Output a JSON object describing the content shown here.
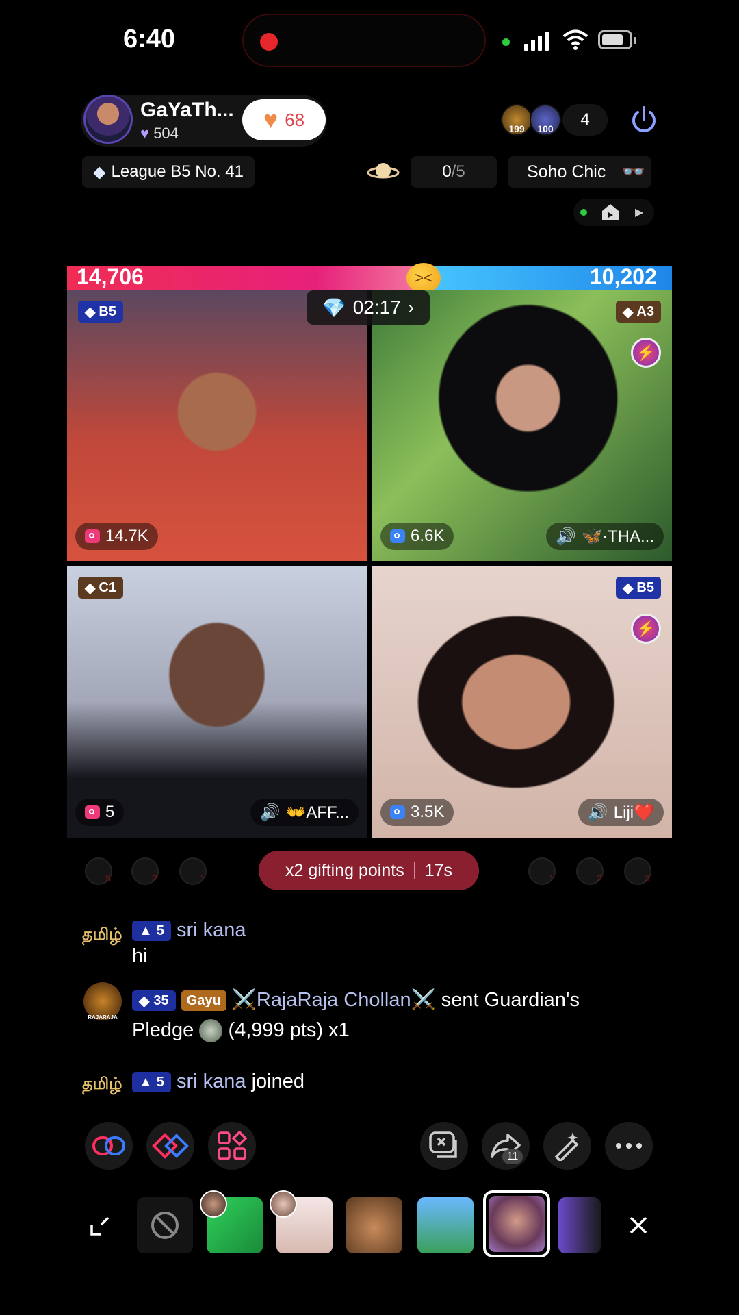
{
  "status_bar": {
    "time": "6:40"
  },
  "host": {
    "name": "GaYaTh...",
    "followers": "504",
    "likes": "68"
  },
  "viewers": {
    "count": "4",
    "avatar1_label": "199",
    "avatar2_label": "100"
  },
  "league": {
    "label": "League B5 No. 41"
  },
  "progress": {
    "current": "0",
    "total": "/5"
  },
  "room_tag": {
    "label": "Soho Chic"
  },
  "battle": {
    "score_left": "14,706",
    "score_right": "10,202",
    "timer": "02:17"
  },
  "tiles": [
    {
      "badge": "B5",
      "stat": "14.7K",
      "name": ""
    },
    {
      "badge": "A3",
      "stat": "6.6K",
      "name": "🦋·THA..."
    },
    {
      "badge": "C1",
      "stat": "5",
      "name": "👐AFF..."
    },
    {
      "badge": "B5",
      "stat": "3.5K",
      "name": "Liji❤️"
    }
  ],
  "gifting": {
    "label": "x2 gifting points",
    "countdown": "17s"
  },
  "ghost_left": [
    "5",
    "2",
    "1"
  ],
  "ghost_right": [
    "1",
    "2",
    "3"
  ],
  "chat": [
    {
      "avatar_text": "தமிழ்",
      "level": "5",
      "user": "sri kana",
      "text": "hi"
    },
    {
      "avatar_text": "RAJARAJA",
      "level": "35",
      "fan_badge": "Gayu",
      "user": "⚔️RajaRaja  Chollan⚔️",
      "text_inline": " sent Guardian's",
      "text": "Pledge",
      "text_tail": "(4,999 pts) x1"
    },
    {
      "avatar_text": "தமிழ்",
      "level": "5",
      "user": "sri kana",
      "text": "joined"
    }
  ],
  "toolbar": {
    "share_count": "11"
  },
  "colors": {
    "pink": "#ef2d55",
    "blue": "#1e86e8",
    "badge_blue": "#1f33a6",
    "gift_red": "#8a1f30"
  }
}
